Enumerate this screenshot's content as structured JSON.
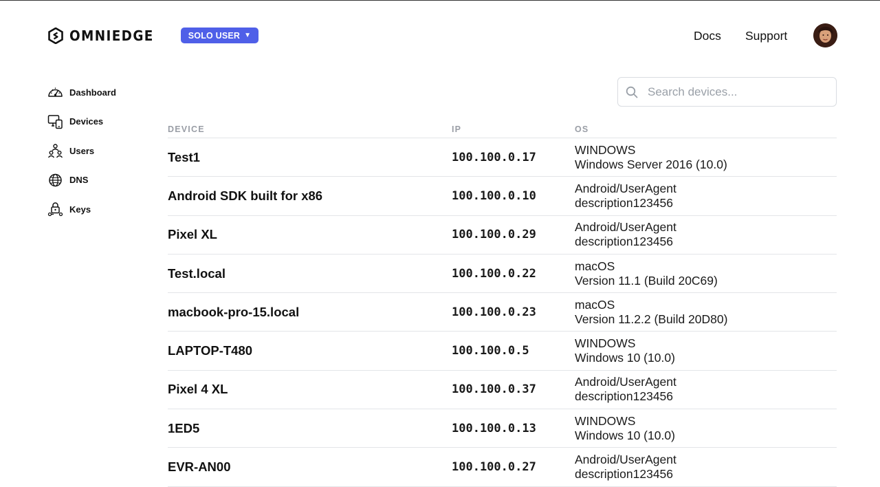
{
  "header": {
    "logo_text": "OMNIEDGE",
    "plan_label": "SOLO USER",
    "nav": {
      "docs": "Docs",
      "support": "Support"
    }
  },
  "sidebar": {
    "items": [
      {
        "label": "Dashboard",
        "icon": "dashboard-icon"
      },
      {
        "label": "Devices",
        "icon": "devices-icon"
      },
      {
        "label": "Users",
        "icon": "users-icon"
      },
      {
        "label": "DNS",
        "icon": "globe-icon"
      },
      {
        "label": "Keys",
        "icon": "keys-icon"
      }
    ]
  },
  "search": {
    "placeholder": "Search devices...",
    "value": ""
  },
  "table": {
    "headers": {
      "device": "DEVICE",
      "ip": "IP",
      "os": "OS"
    },
    "rows": [
      {
        "device": "Test1",
        "ip": "100.100.0.17",
        "os": "WINDOWS",
        "os_detail": "Windows Server 2016 (10.0)"
      },
      {
        "device": "Android SDK built for x86",
        "ip": "100.100.0.10",
        "os": "Android/UserAgent",
        "os_detail": "description123456"
      },
      {
        "device": "Pixel XL",
        "ip": "100.100.0.29",
        "os": "Android/UserAgent",
        "os_detail": "description123456"
      },
      {
        "device": "Test.local",
        "ip": "100.100.0.22",
        "os": "macOS",
        "os_detail": "Version 11.1 (Build 20C69)"
      },
      {
        "device": "macbook-pro-15.local",
        "ip": "100.100.0.23",
        "os": "macOS",
        "os_detail": "Version 11.2.2 (Build 20D80)"
      },
      {
        "device": "LAPTOP-T480",
        "ip": "100.100.0.5",
        "os": "WINDOWS",
        "os_detail": "Windows 10 (10.0)"
      },
      {
        "device": "Pixel 4 XL",
        "ip": "100.100.0.37",
        "os": "Android/UserAgent",
        "os_detail": "description123456"
      },
      {
        "device": "1ED5",
        "ip": "100.100.0.13",
        "os": "WINDOWS",
        "os_detail": "Windows 10 (10.0)"
      },
      {
        "device": "EVR-AN00",
        "ip": "100.100.0.27",
        "os": "Android/UserAgent",
        "os_detail": "description123456"
      }
    ]
  },
  "colors": {
    "accent": "#4f5fe8",
    "header_text": "#9a9ea6",
    "border": "#e3e5e8"
  }
}
